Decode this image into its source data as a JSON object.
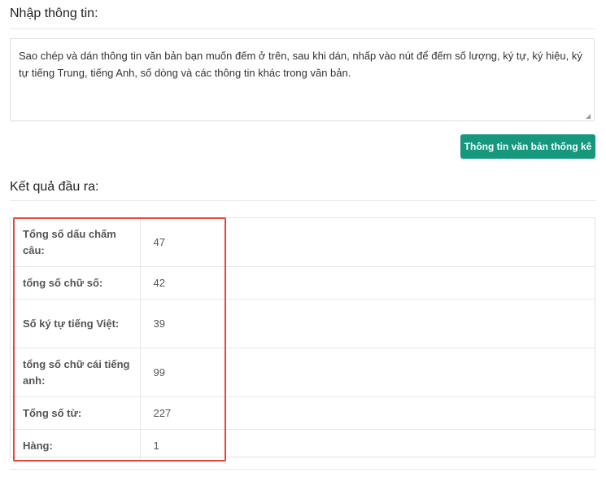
{
  "input_section": {
    "title": "Nhập thông tin:",
    "textarea_value": "Sao chép và dán thông tin văn bản bạn muốn đếm ở trên, sau khi dán, nhấp vào nút để đếm số lượng, ký tự, ký hiệu, ký tự tiếng Trung, tiếng Anh, số dòng và các thông tin khác trong văn bản."
  },
  "action": {
    "button_label": "Thông tin văn bản thống kê",
    "button_color": "#16987e"
  },
  "output_section": {
    "title": "Kết quả đầu ra:",
    "highlight_color": "#e8453c",
    "rows": [
      {
        "label": "Tổng số dấu chấm câu:",
        "value": "47"
      },
      {
        "label": "tổng số chữ số:",
        "value": "42"
      },
      {
        "label": "Số ký tự tiếng Việt:",
        "value": "39"
      },
      {
        "label": "tổng số chữ cái tiếng anh:",
        "value": "99"
      },
      {
        "label": "Tổng số từ:",
        "value": "227"
      },
      {
        "label": "Hàng:",
        "value": "1"
      }
    ]
  }
}
